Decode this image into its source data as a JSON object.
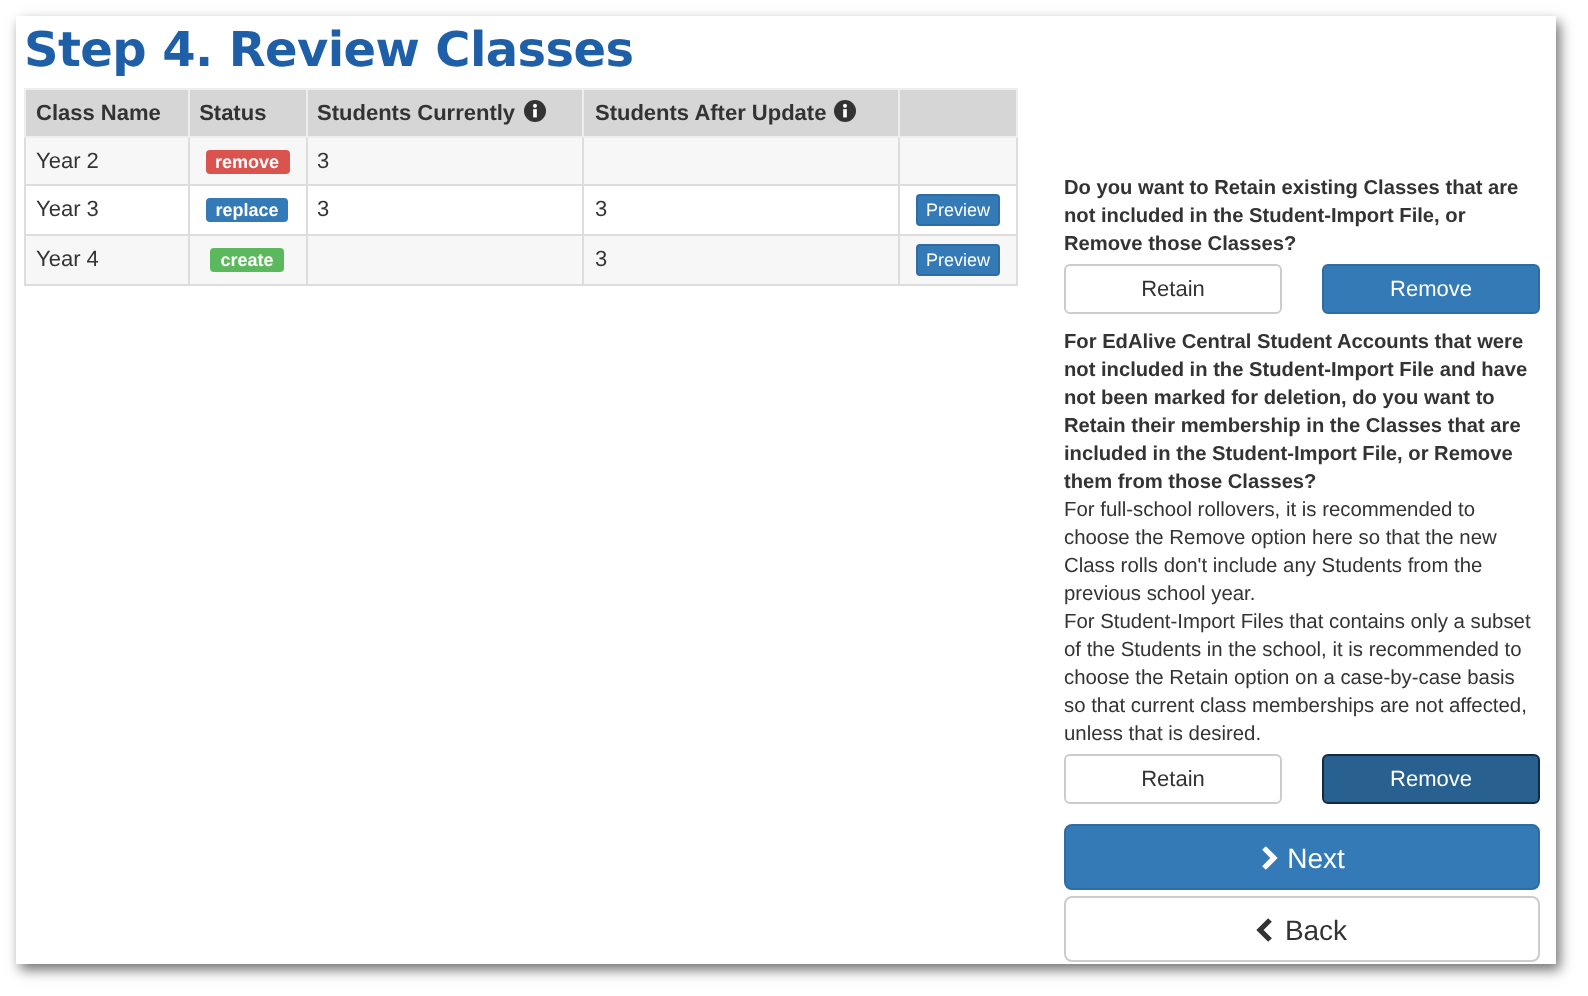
{
  "title": "Step 4. Review Classes",
  "table": {
    "columns": [
      {
        "label": "Class Name",
        "info": false
      },
      {
        "label": "Status",
        "info": false
      },
      {
        "label": "Students Currently",
        "info": true
      },
      {
        "label": "Students After Update",
        "info": true
      },
      {
        "info": false
      }
    ],
    "rows": [
      {
        "class_name": "Year 2",
        "status": {
          "label": "remove",
          "color": "#d9534f"
        },
        "students_currently": "3"
      },
      {
        "class_name": "Year 3",
        "status": {
          "label": "replace",
          "color": "#337ab7"
        },
        "students_currently": "3",
        "students_after_update": "3",
        "action": "Preview"
      },
      {
        "class_name": "Year 4",
        "status": {
          "label": "create",
          "color": "#5cb85c"
        },
        "students_after_update": "3",
        "action": "Preview"
      }
    ]
  },
  "questions": [
    {
      "question": "Do you want to Retain existing Classes that are not included in the Student-Import File, or Remove those Classes?",
      "options": [
        {
          "label": "Retain",
          "selected": false,
          "focused": false
        },
        {
          "label": "Remove",
          "selected": true,
          "focused": false
        }
      ]
    },
    {
      "question": "For EdAlive Central Student Accounts that were not included in the Student-Import File and have not been marked for deletion, do you want to Retain their membership in the Classes that are included in the Student-Import File, or Remove them from those Classes?",
      "notes": [
        "For full-school rollovers, it is recommended to choose the Remove option here so that the new Class rolls don't include any Students from the previous school year.",
        "For Student-Import Files that contains only a subset of the Students in the school, it is recommended to choose the Retain option on a case-by-case basis so that current class memberships are not affected, unless that is desired."
      ],
      "options": [
        {
          "label": "Retain",
          "selected": false,
          "focused": false
        },
        {
          "label": "Remove",
          "selected": true,
          "focused": true
        }
      ]
    }
  ],
  "next_button": "Next",
  "back_button": "Back"
}
